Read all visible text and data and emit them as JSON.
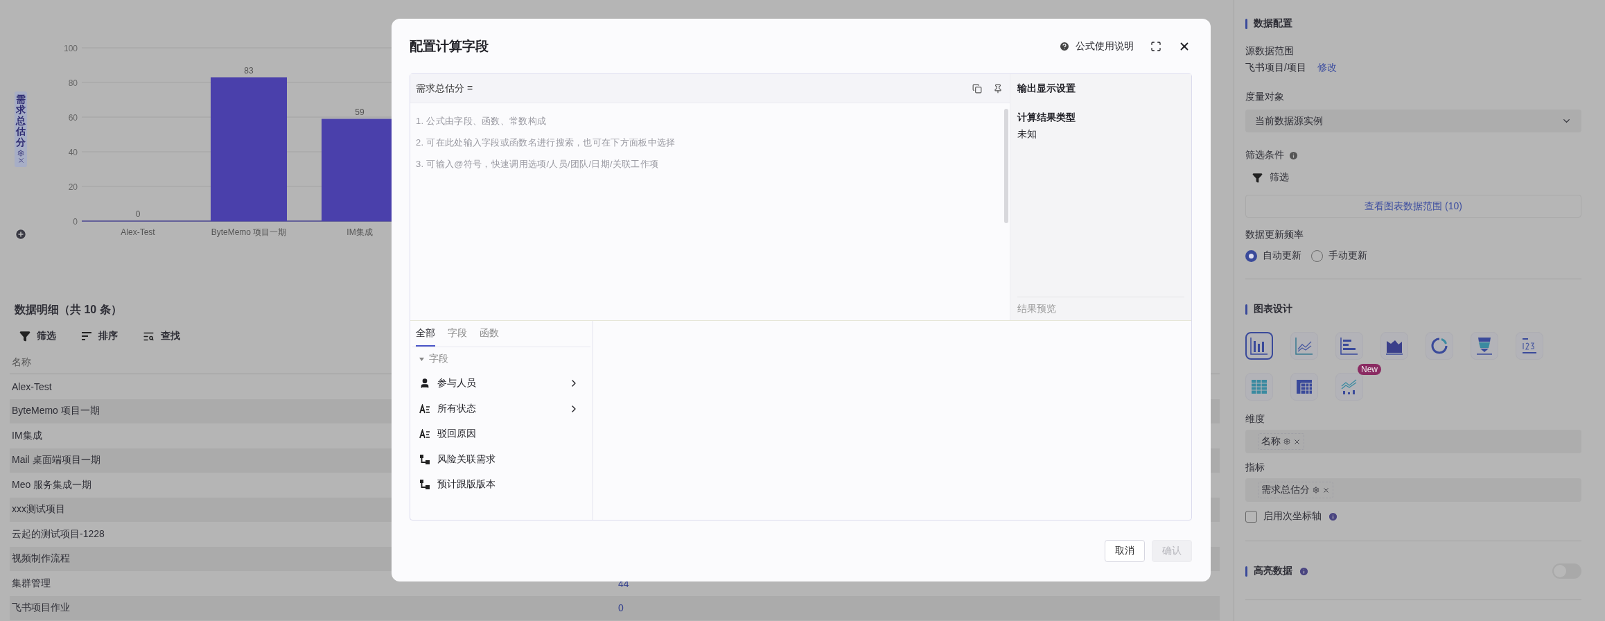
{
  "chart": {
    "axis_tag": "需求总估分",
    "chart_data": {
      "type": "bar",
      "categories": [
        "Alex-Test",
        "ByteMemo 项目一期",
        "IM集成"
      ],
      "values": [
        0,
        83,
        59
      ],
      "grid": true,
      "ylim": [
        0,
        100
      ],
      "yticks": [
        0,
        20,
        40,
        60,
        80,
        100
      ],
      "data_labels": true
    }
  },
  "table": {
    "title": "数据明细（共 10 条）",
    "toolbar": [
      {
        "kind": "filter",
        "label": "筛选"
      },
      {
        "kind": "sort",
        "label": "排序"
      },
      {
        "kind": "find",
        "label": "查找"
      }
    ],
    "columns": [
      "名称"
    ],
    "rows": [
      {
        "name": "Alex-Test"
      },
      {
        "name": "ByteMemo 项目一期"
      },
      {
        "name": "IM集成"
      },
      {
        "name": "Mail 桌面端项目一期"
      },
      {
        "name": "Meo 服务集成一期"
      },
      {
        "name": "xxx测试项目"
      },
      {
        "name": "云起的测试项目-1228"
      },
      {
        "name": "视频制作流程"
      },
      {
        "name": "集群管理",
        "value": "44"
      },
      {
        "name": "飞书项目作业",
        "value": "0"
      }
    ]
  },
  "dialog": {
    "title": "配置计算字段",
    "help_link": "公式使用说明",
    "formula_label": "需求总估分 =",
    "hints": [
      "1. 公式由字段、函数、常数构成",
      "2. 可在此处输入字段或函数名进行搜索，也可在下方面板中选择",
      "3. 可输入@符号，快速调用选项/人员/团队/日期/关联工作项"
    ],
    "output": {
      "title": "输出显示设置",
      "result_type_label": "计算结果类型",
      "result_type": "未知",
      "preview_label": "结果预览"
    },
    "tabs": [
      {
        "label": "全部",
        "selected": true
      },
      {
        "label": "字段",
        "selected": false
      },
      {
        "label": "函数",
        "selected": false
      }
    ],
    "tree": {
      "label": "字段",
      "expanded": true,
      "children": [
        {
          "kind": "person",
          "label": "参与人员",
          "has_submenu": true
        },
        {
          "kind": "text",
          "label": "所有状态",
          "has_submenu": true
        },
        {
          "kind": "text",
          "label": "驳回原因",
          "has_submenu": false
        },
        {
          "kind": "link",
          "label": "风险关联需求",
          "has_submenu": false
        },
        {
          "kind": "link",
          "label": "预计跟版版本",
          "has_submenu": false
        }
      ]
    },
    "buttons": [
      {
        "label": "取消",
        "disabled": false
      },
      {
        "label": "确认",
        "disabled": true
      }
    ]
  },
  "config": {
    "data_section": {
      "title": "数据配置",
      "source_label": "源数据范围",
      "source_value": "飞书项目/项目",
      "source_edit": "修改",
      "measure_label": "度量对象",
      "measure_value": "当前数据源实例",
      "filter_label": "筛选条件",
      "filter_button": "筛选",
      "range_button": "查看图表数据范围 (10)",
      "refresh_label": "数据更新频率",
      "refresh_options": [
        {
          "label": "自动更新",
          "selected": true
        },
        {
          "label": "手动更新",
          "selected": false
        }
      ]
    },
    "design_section": {
      "title": "图表设计",
      "chart_types": [
        {
          "kind": "bar",
          "selected": true
        },
        {
          "kind": "line",
          "selected": false
        },
        {
          "kind": "hbar",
          "selected": false
        },
        {
          "kind": "area",
          "selected": false
        },
        {
          "kind": "donut",
          "selected": false
        },
        {
          "kind": "funnel",
          "selected": false
        },
        {
          "kind": "number",
          "selected": false
        },
        {
          "kind": "table",
          "selected": false
        },
        {
          "kind": "pivot",
          "selected": false
        },
        {
          "kind": "combo",
          "selected": false,
          "badge": "New"
        }
      ],
      "dimension_label": "维度",
      "dimension_chips": [
        "名称"
      ],
      "metric_label": "指标",
      "metric_chips": [
        "需求总估分"
      ],
      "secondary_axis": {
        "label": "启用次坐标轴",
        "checked": false
      }
    },
    "highlight_section": {
      "title": "高亮数据",
      "on": false
    }
  }
}
